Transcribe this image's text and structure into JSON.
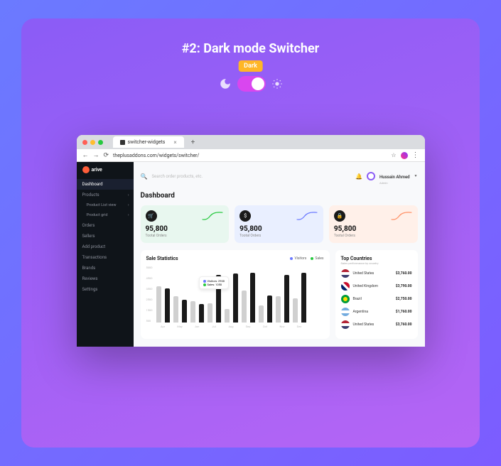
{
  "banner": {
    "title": "#2: Dark mode Switcher",
    "badge": "Dark"
  },
  "browser": {
    "tab": "switcher-widgets",
    "url": "theplusaddons.com/widgets/switcher/"
  },
  "user": {
    "name": "Hussain Ahmed",
    "role": "Admin"
  },
  "search": {
    "placeholder": "Search order products, etc."
  },
  "sidebar": {
    "brand": "arive",
    "items": [
      {
        "label": "Dashboard",
        "active": true
      },
      {
        "label": "Products",
        "exp": true
      },
      {
        "label": "Product List view",
        "sub": true,
        "exp": true
      },
      {
        "label": "Product grid",
        "sub": true,
        "exp": true
      },
      {
        "label": "Orders"
      },
      {
        "label": "Sellers"
      },
      {
        "label": "Add product"
      },
      {
        "label": "Transactions"
      },
      {
        "label": "Brands"
      },
      {
        "label": "Reviews"
      },
      {
        "label": "Settings"
      }
    ]
  },
  "page": {
    "title": "Dashboard"
  },
  "stats": [
    {
      "value": "95,800",
      "label": "Tootal Orders",
      "color": "g",
      "icon": "🛒"
    },
    {
      "value": "95,800",
      "label": "Tootal Orders",
      "color": "b",
      "icon": "$"
    },
    {
      "value": "95,800",
      "label": "Tootal Orders",
      "color": "o",
      "icon": "🔒"
    }
  ],
  "chart": {
    "title": "Sale Statistics",
    "legend": {
      "visitors": "Visitors",
      "sales": "Sales"
    },
    "tooltip": {
      "visitors": "Visitors: 2930",
      "sales": "Sales: 1050"
    }
  },
  "chart_data": {
    "type": "bar",
    "categories": [
      "Apr",
      "May",
      "Jun",
      "Jul",
      "Aug",
      "Sep",
      "Oct",
      "Nov",
      "Dec"
    ],
    "series": [
      {
        "name": "Visitors",
        "values": [
          3200,
          2300,
          1900,
          1700,
          1200,
          2800,
          1500,
          2300,
          2100
        ]
      },
      {
        "name": "Sales",
        "values": [
          3000,
          2000,
          1600,
          4200,
          4300,
          4400,
          2400,
          4200,
          4400
        ]
      }
    ],
    "ylabels": [
      "5000",
      "4500",
      "3500",
      "2500",
      "1500",
      "500"
    ],
    "ylim": [
      0,
      5000
    ],
    "xlabel": "",
    "ylabel": ""
  },
  "countries": {
    "title": "Top Countries",
    "subtitle": "Sales performance by country",
    "rows": [
      {
        "flag": "us",
        "name": "United States",
        "value": "$3,760.00"
      },
      {
        "flag": "uk",
        "name": "United Kingdom",
        "value": "$3,790.00"
      },
      {
        "flag": "br",
        "name": "Brazil",
        "value": "$2,750.00"
      },
      {
        "flag": "ar",
        "name": "Argentina",
        "value": "$1,760.00"
      },
      {
        "flag": "us",
        "name": "United States",
        "value": "$3,760.00"
      }
    ]
  }
}
